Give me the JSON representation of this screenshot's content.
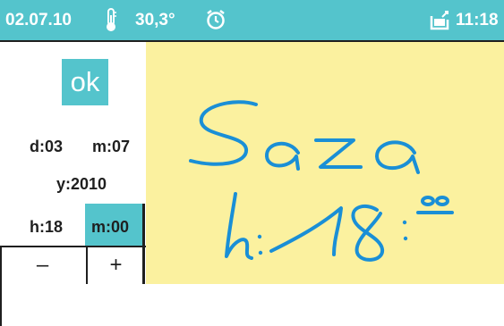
{
  "status_bar": {
    "date": "02.07.10",
    "temperature": "30,3°",
    "time": "11:18",
    "icons": [
      "thermometer-icon",
      "alarm-clock-icon",
      "message-icon"
    ]
  },
  "edit_panel": {
    "ok_label": "ok",
    "day": "d:03",
    "month": "m:07",
    "year": "y:2010",
    "hour": "h:18",
    "minute": "m:00",
    "minus_label": "–",
    "plus_label": "+"
  },
  "note": {
    "handwritten_text": "Sara h: 18:00"
  },
  "colors": {
    "accent": "#54c4cc",
    "note_background": "#fbf19f",
    "ink": "#1a8fd6"
  }
}
